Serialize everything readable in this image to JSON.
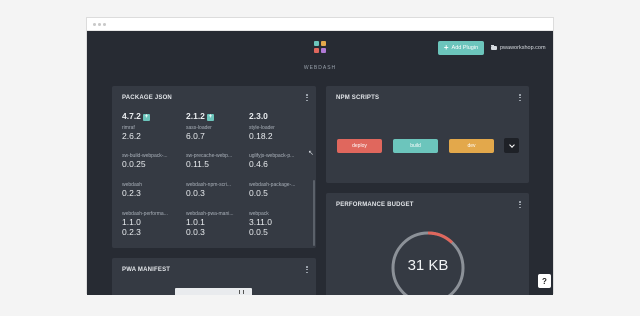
{
  "header": {
    "brand": "WEBDASH",
    "add_plugin": "Add Plugin",
    "plus": "+",
    "site": "pwaworkshop.com"
  },
  "package_json": {
    "title": "PACKAGE JSON",
    "top_versions": [
      {
        "value": "4.7.2",
        "badge": "+"
      },
      {
        "value": "2.1.2",
        "badge": "+"
      },
      {
        "value": "2.3.0",
        "badge": ""
      }
    ],
    "items": [
      {
        "label": "rimraf",
        "value": "2.6.2"
      },
      {
        "label": "sass-loader",
        "value": "6.0.7"
      },
      {
        "label": "style-loader",
        "value": "0.18.2"
      },
      {
        "label": "sw-build-webpack-...",
        "value": "0.0.25"
      },
      {
        "label": "sw-precache-webp...",
        "value": "0.11.5"
      },
      {
        "label": "uglifyjs-webpack-p...",
        "value": "0.4.6"
      },
      {
        "label": "webdash",
        "value": "0.2.3"
      },
      {
        "label": "webdash-npm-scri...",
        "value": "0.0.3"
      },
      {
        "label": "webdash-package-...",
        "value": "0.0.5"
      },
      {
        "label": "webdash-performa...",
        "value": "1.1.0",
        "value2": "0.2.3"
      },
      {
        "label": "webdash-pwa-mani...",
        "value": "1.0.1",
        "value2": "0.0.3"
      },
      {
        "label": "webpack",
        "value": "3.11.0",
        "value2": "0.0.5"
      }
    ]
  },
  "npm_scripts": {
    "title": "NPM SCRIPTS",
    "buttons": [
      {
        "label": "deploy",
        "color": "#e0675d"
      },
      {
        "label": "build",
        "color": "#6cc5bc"
      },
      {
        "label": "dev",
        "color": "#e3a84b"
      }
    ]
  },
  "performance_budget": {
    "title": "PERFORMANCE BUDGET",
    "value": "31 KB",
    "fraction": 0.12
  },
  "pwa_manifest": {
    "title": "PWA MANIFEST"
  },
  "help": "?",
  "colors": {
    "accent": "#6cc5bc",
    "background": "#272b33",
    "card": "#353a43"
  }
}
